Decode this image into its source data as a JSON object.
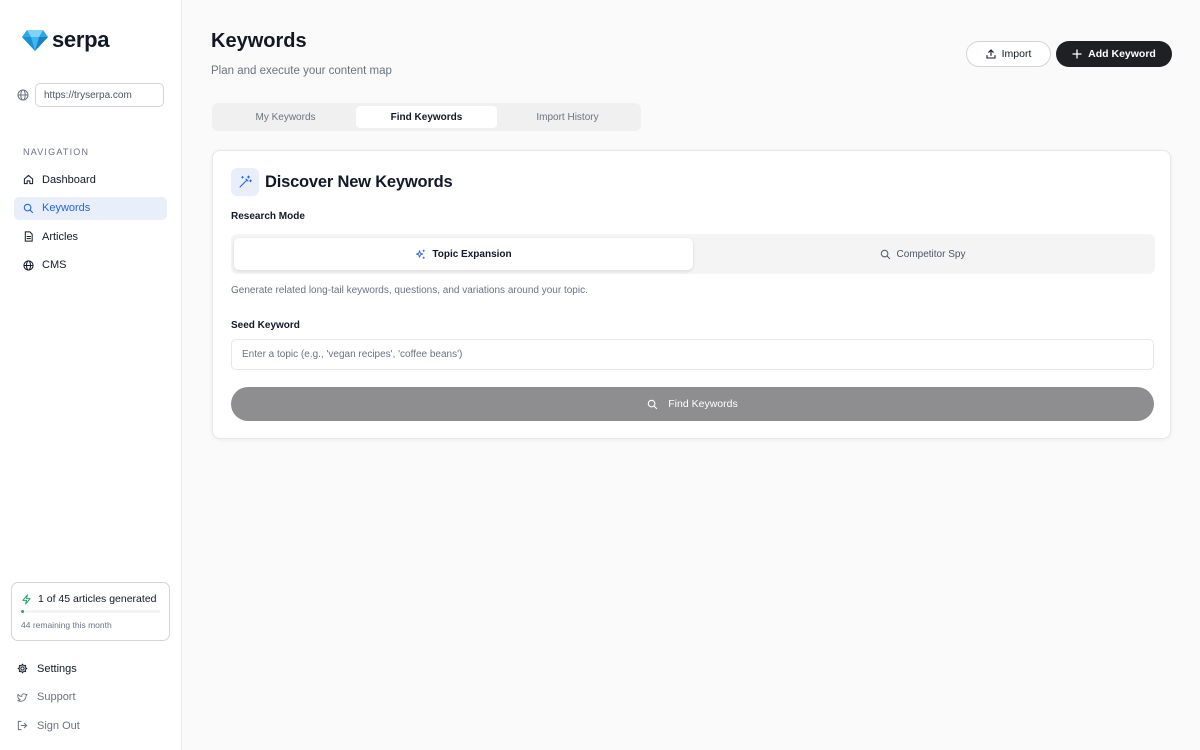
{
  "brand": {
    "name": "serpa"
  },
  "sidebar": {
    "site_url": "https://tryserpa.com",
    "nav_heading": "NAVIGATION",
    "nav_items": [
      {
        "label": "Dashboard",
        "icon": "home-icon",
        "active": false
      },
      {
        "label": "Keywords",
        "icon": "search-icon",
        "active": true
      },
      {
        "label": "Articles",
        "icon": "document-icon",
        "active": false
      },
      {
        "label": "CMS",
        "icon": "globe-icon",
        "active": false
      }
    ],
    "usage": {
      "title": "1 of 45 articles generated",
      "subtitle": "44 remaining this month",
      "progress": 0.022
    },
    "bottom_items": [
      {
        "label": "Settings",
        "icon": "gear-icon"
      },
      {
        "label": "Support",
        "icon": "twitter-icon"
      },
      {
        "label": "Sign Out",
        "icon": "logout-icon"
      }
    ]
  },
  "header": {
    "title": "Keywords",
    "subtitle": "Plan and execute your content map",
    "import_label": "Import",
    "add_label": "Add Keyword"
  },
  "tabs": [
    {
      "label": "My Keywords",
      "active": false
    },
    {
      "label": "Find Keywords",
      "active": true
    },
    {
      "label": "Import History",
      "active": false
    }
  ],
  "discover": {
    "title": "Discover New Keywords",
    "research_mode_label": "Research Mode",
    "modes": [
      {
        "label": "Topic Expansion",
        "icon": "sparkles-icon",
        "active": true
      },
      {
        "label": "Competitor Spy",
        "icon": "search-icon",
        "active": false
      }
    ],
    "helper_text": "Generate related long-tail keywords, questions, and variations around your topic.",
    "seed_label": "Seed Keyword",
    "seed_placeholder": "Enter a topic (e.g., 'vegan recipes', 'coffee beans')",
    "seed_value": "",
    "find_button": "Find Keywords"
  },
  "colors": {
    "accent": "#2563eb",
    "active_nav_bg": "#e8effb",
    "primary_button": "#1f2023",
    "disabled_button": "#8e8e90",
    "progress": "#22a06b"
  }
}
